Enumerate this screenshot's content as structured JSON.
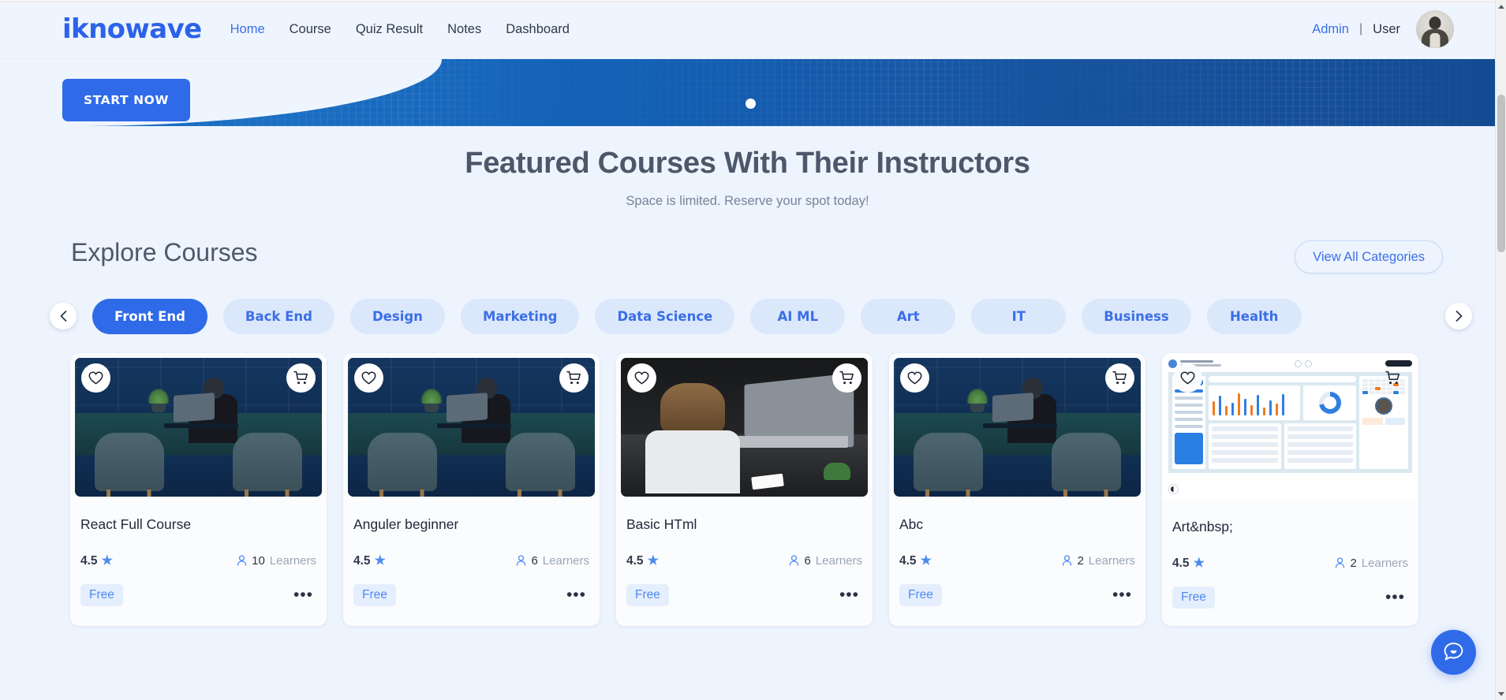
{
  "brand": "iknowave",
  "nav": {
    "items": [
      {
        "label": "Home",
        "active": true
      },
      {
        "label": "Course",
        "active": false
      },
      {
        "label": "Quiz Result",
        "active": false
      },
      {
        "label": "Notes",
        "active": false
      },
      {
        "label": "Dashboard",
        "active": false
      }
    ]
  },
  "header_right": {
    "admin_label": "Admin",
    "separator": "|",
    "user_label": "User",
    "avatar_icon": "user-avatar-photo"
  },
  "banner": {
    "start_now_label": "START NOW",
    "carousel_dot": "active-slide-dot"
  },
  "featured": {
    "title": "Featured Courses With Their Instructors",
    "subtitle": "Space is limited. Reserve your spot today!"
  },
  "explore": {
    "title": "Explore Courses",
    "view_all_label": "View All Categories"
  },
  "categories": {
    "prev_icon": "chevron-left-icon",
    "next_icon": "chevron-right-icon",
    "items": [
      {
        "label": "Front End",
        "active": true
      },
      {
        "label": "Back End",
        "active": false
      },
      {
        "label": "Design",
        "active": false
      },
      {
        "label": "Marketing",
        "active": false
      },
      {
        "label": "Data Science",
        "active": false
      },
      {
        "label": "AI ML",
        "active": false
      },
      {
        "label": "Art",
        "active": false
      },
      {
        "label": "IT",
        "active": false
      },
      {
        "label": "Business",
        "active": false
      },
      {
        "label": "Health",
        "active": false
      }
    ]
  },
  "cards": {
    "learners_label": "Learners",
    "more_icon": "ellipsis-icon",
    "heart_icon": "heart-icon",
    "cart_icon": "cart-icon",
    "star_icon": "star-icon",
    "person_icon": "person-icon",
    "items": [
      {
        "title": "React Full Course",
        "rating": "4.5",
        "learners": "10",
        "price": "Free",
        "thumb": "office-desk-photo"
      },
      {
        "title": "Anguler beginner",
        "rating": "4.5",
        "learners": "6",
        "price": "Free",
        "thumb": "office-desk-photo"
      },
      {
        "title": "Basic HTml",
        "rating": "4.5",
        "learners": "6",
        "price": "Free",
        "thumb": "laptop-stress-photo"
      },
      {
        "title": "Abc",
        "rating": "4.5",
        "learners": "2",
        "price": "Free",
        "thumb": "office-desk-photo"
      },
      {
        "title": "Art&nbsp;",
        "rating": "4.5",
        "learners": "2",
        "price": "Free",
        "thumb": "dashboard-screenshot"
      }
    ]
  },
  "chat": {
    "icon": "chat-bubble-icon"
  },
  "colors": {
    "accent_blue": "#2f6ae8",
    "chip_bg": "#dbe8fb",
    "page_bg": "#eef4fd",
    "banner_blue": "#1565b8",
    "star_blue": "#4d8df0"
  }
}
